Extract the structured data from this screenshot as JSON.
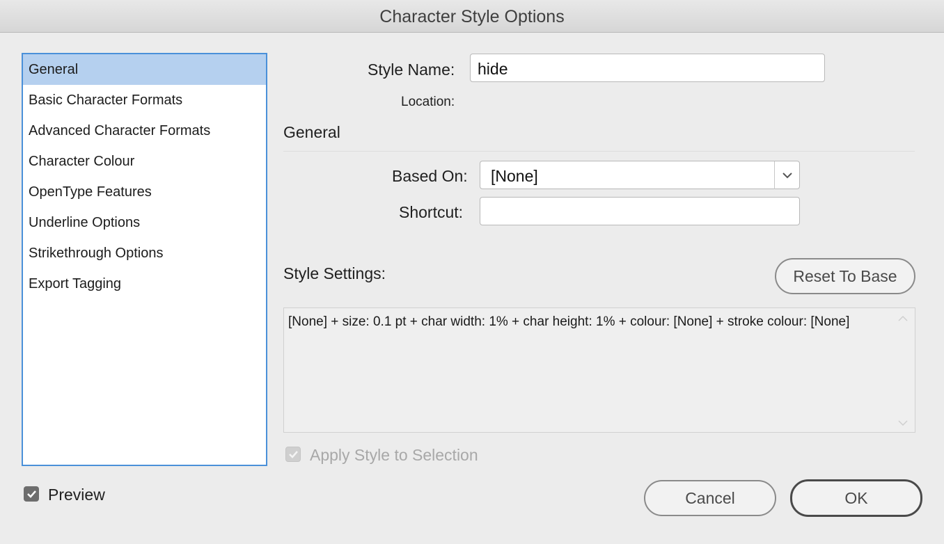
{
  "window": {
    "title": "Character Style Options"
  },
  "sidebar": {
    "items": [
      {
        "label": "General",
        "selected": true
      },
      {
        "label": "Basic Character Formats"
      },
      {
        "label": "Advanced Character Formats"
      },
      {
        "label": "Character Colour"
      },
      {
        "label": "OpenType Features"
      },
      {
        "label": "Underline Options"
      },
      {
        "label": "Strikethrough Options"
      },
      {
        "label": "Export Tagging"
      }
    ]
  },
  "form": {
    "style_name_label": "Style Name:",
    "style_name_value": "hide",
    "location_label": "Location:",
    "section_title": "General",
    "based_on_label": "Based On:",
    "based_on_value": "[None]",
    "shortcut_label": "Shortcut:",
    "shortcut_value": ""
  },
  "style_settings": {
    "label": "Style Settings:",
    "reset_button": "Reset To Base",
    "text": "[None] + size: 0.1 pt + char width: 1% + char height: 1% + colour: [None] + stroke colour: [None]"
  },
  "apply_style": {
    "label": "Apply Style to Selection",
    "checked": true,
    "disabled": true
  },
  "preview": {
    "label": "Preview",
    "checked": true
  },
  "buttons": {
    "cancel": "Cancel",
    "ok": "OK"
  },
  "colors": {
    "accent": "#4a90d9",
    "selection": "#b5d0ef",
    "checkbox": "#6d6d6d"
  }
}
